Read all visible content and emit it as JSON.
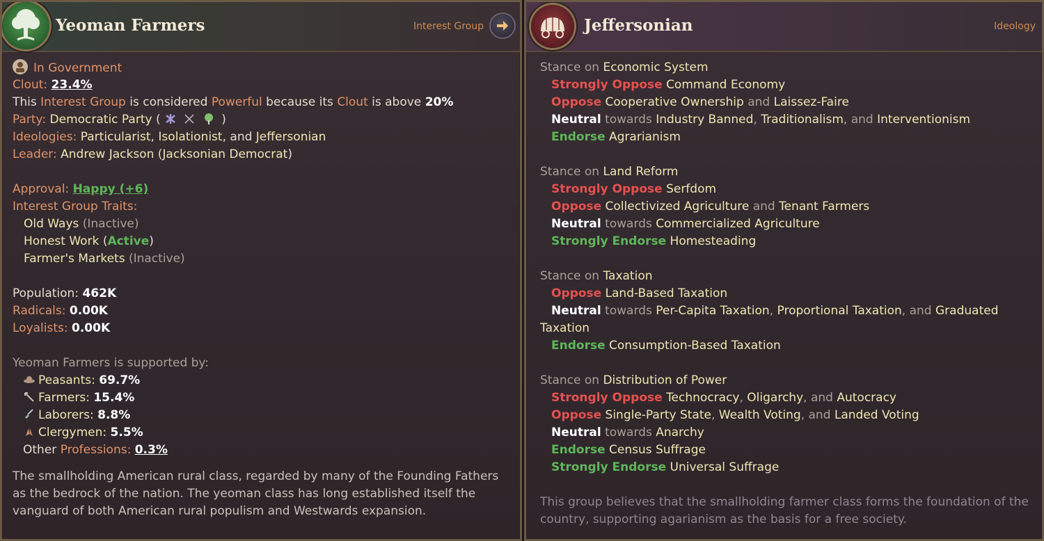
{
  "left": {
    "title": "Yeoman Farmers",
    "kind": "Interest Group",
    "status": "In Government",
    "clout_label": "Clout:",
    "clout_value": "23.4%",
    "powerful": {
      "p1": "This",
      "p2": "Interest Group",
      "p3": "is considered",
      "p4": "Powerful",
      "p5": "because its",
      "p6": "Clout",
      "p7": "is above",
      "p8": "20%"
    },
    "party": {
      "label": "Party:",
      "value": "Democratic Party",
      "open": "(",
      "close": ")"
    },
    "ideologies": {
      "label": "Ideologies:",
      "i1": "Particularist",
      "i2": "Isolationist",
      "and": "and",
      "i3": "Jeffersonian"
    },
    "leader": {
      "label": "Leader:",
      "name": "Andrew Jackson",
      "open": "(",
      "title": "Jacksonian Democrat",
      "close": ")"
    },
    "approval": {
      "label": "Approval:",
      "value": "Happy (+6)"
    },
    "traits_label": "Interest Group Traits:",
    "traits": [
      {
        "name": "Old Ways",
        "state": "(Inactive)"
      },
      {
        "name": "Honest Work",
        "state": "Active"
      },
      {
        "name": "Farmer's Markets",
        "state": "(Inactive)"
      }
    ],
    "population": {
      "label": "Population:",
      "value": "462K"
    },
    "radicals": {
      "label": "Radicals:",
      "value": "0.00K"
    },
    "loyalists": {
      "label": "Loyalists:",
      "value": "0.00K"
    },
    "supported_by": "Yeoman Farmers is supported by:",
    "supporters": [
      {
        "name": "Peasants:",
        "value": "69.7%"
      },
      {
        "name": "Farmers:",
        "value": "15.4%"
      },
      {
        "name": "Laborers:",
        "value": "8.8%"
      },
      {
        "name": "Clergymen:",
        "value": "5.5%"
      }
    ],
    "other": {
      "p1": "Other",
      "p2": "Professions:",
      "value": "0.3%"
    },
    "description": "The smallholding American rural class, regarded by many of the Founding Fathers as the bedrock of the nation. The yeoman class has long established itself the vanguard of both American rural populism and Westwards expansion."
  },
  "right": {
    "title": "Jeffersonian",
    "kind": "Ideology",
    "stance": "Stance",
    "on": "on",
    "towards": "towards",
    "and": "and",
    "topics": [
      {
        "name": "Economic System"
      },
      {
        "name": "Land Reform"
      },
      {
        "name": "Taxation"
      },
      {
        "name": "Distribution of Power"
      }
    ],
    "econ": {
      "so_label": "Strongly Oppose",
      "so": "Command Economy",
      "o_label": "Oppose",
      "o1": "Cooperative Ownership",
      "o2": "Laissez-Faire",
      "n_label": "Neutral",
      "n1": "Industry Banned",
      "n2": "Traditionalism",
      "n3": "Interventionism",
      "e_label": "Endorse",
      "e1": "Agrarianism"
    },
    "land": {
      "so_label": "Strongly Oppose",
      "so": "Serfdom",
      "o_label": "Oppose",
      "o1": "Collectivized Agriculture",
      "o2": "Tenant Farmers",
      "n_label": "Neutral",
      "n1": "Commercialized Agriculture",
      "se_label": "Strongly Endorse",
      "se1": "Homesteading"
    },
    "tax": {
      "o_label": "Oppose",
      "o1": "Land-Based Taxation",
      "n_label": "Neutral",
      "n1": "Per-Capita Taxation",
      "n2": "Proportional Taxation",
      "n3a": "Graduated",
      "n3b": "Taxation",
      "e_label": "Endorse",
      "e1": "Consumption-Based Taxation"
    },
    "power": {
      "so_label": "Strongly Oppose",
      "so1": "Technocracy",
      "so2": "Oligarchy",
      "so3": "Autocracy",
      "o_label": "Oppose",
      "o1": "Single-Party State",
      "o2": "Wealth Voting",
      "o3": "Landed Voting",
      "n_label": "Neutral",
      "n1": "Anarchy",
      "e_label": "Endorse",
      "e1": "Census Suffrage",
      "se_label": "Strongly Endorse",
      "se1": "Universal Suffrage"
    },
    "description": "This group believes that the smallholding farmer class forms the foundation of the country, supporting agarianism as the basis for a free society."
  }
}
